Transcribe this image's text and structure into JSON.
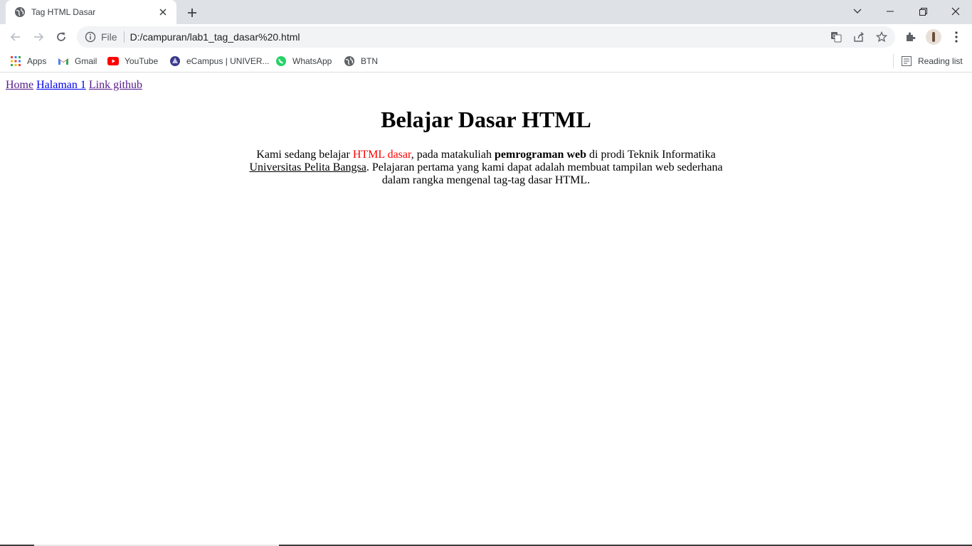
{
  "browser": {
    "tab": {
      "title": "Tag HTML Dasar"
    },
    "address": {
      "scheme": "File",
      "url": "D:/campuran/lab1_tag_dasar%20.html"
    },
    "bookmarks": [
      {
        "label": "Apps",
        "icon": "apps-grid-icon"
      },
      {
        "label": "Gmail",
        "icon": "gmail-icon"
      },
      {
        "label": "YouTube",
        "icon": "youtube-icon"
      },
      {
        "label": "eCampus | UNIVER...",
        "icon": "ecampus-icon"
      },
      {
        "label": "WhatsApp",
        "icon": "whatsapp-icon"
      },
      {
        "label": "BTN",
        "icon": "globe-icon"
      }
    ],
    "reading_list": "Reading list",
    "colors": {
      "tabstrip": "#dee1e6",
      "omnibox": "#f1f3f4",
      "link_visited": "#551a8b",
      "link": "#0000ee",
      "accent_red": "#ff0000"
    }
  },
  "page": {
    "nav": [
      "Home",
      "Halaman 1",
      "Link github"
    ],
    "heading": "Belajar Dasar HTML",
    "paragraph": {
      "t1": "Kami sedang belajar ",
      "red": "HTML dasar",
      "t2": ", pada matakuliah ",
      "bold": "pemrograman web",
      "t3": " di prodi Teknik Informatika ",
      "underline": "Universitas Pelita Bangsa",
      "t4": ". Pelajaran pertama yang kami dapat adalah membuat tampilan web sederhana dalam rangka mengenal tag-tag dasar HTML."
    }
  }
}
